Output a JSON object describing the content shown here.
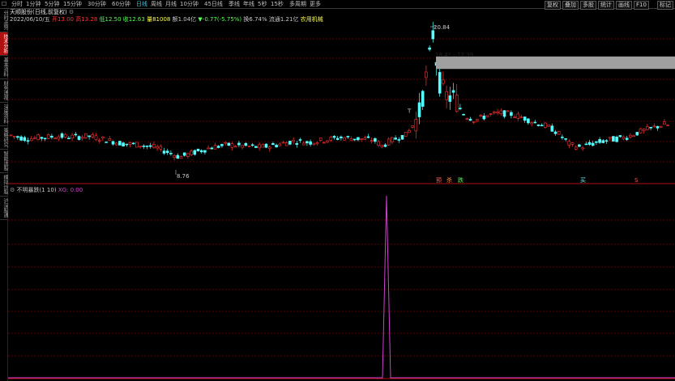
{
  "toolbar": {
    "periods": [
      "分时",
      "1分钟",
      "5分钟",
      "15分钟",
      "30分钟",
      "60分钟",
      "日线",
      "周线",
      "月线",
      "10分钟",
      "45日线",
      "季线",
      "年线",
      "5秒",
      "15秒",
      "多周期",
      "更多"
    ],
    "active_period": "日线",
    "right_buttons": [
      "复权",
      "叠加",
      "多股",
      "统计",
      "画线",
      "F10",
      "标记"
    ]
  },
  "left_tabs": [
    "分时走势",
    "技术分析",
    "基本资料",
    "财务透视",
    "深度资料",
    "策略研究",
    "智能选股",
    "模拟炒股",
    "沪深股通"
  ],
  "left_tab_active": 1,
  "stock": {
    "name": "天顺股份(日线,前复权)",
    "date": "2022/06/10/五",
    "open": "开13.00",
    "high": "高13.28",
    "low": "低12.50",
    "close": "收12.63",
    "volume": "量81008",
    "amount": "额1.04亿",
    "change": "-0.77(-5.75%)",
    "turnover": "换6.74%",
    "float_cap": "流通1.21亿",
    "tag": "农用机械"
  },
  "annotations": {
    "high": "20.84",
    "range": "18.41 - 17.39",
    "low": "8.76"
  },
  "signals": [
    "预",
    "杀",
    "跌",
    "买",
    "S"
  ],
  "indicator": {
    "name": "不明暴跌(1 10)",
    "value_label": "XG: 0.00",
    "value": 0.0
  },
  "colors": {
    "up": "#ff3232",
    "down": "#54ffff",
    "grid": "#7a0000",
    "gap_band": "#a0a0a0",
    "indicator": "#d040d0"
  }
}
